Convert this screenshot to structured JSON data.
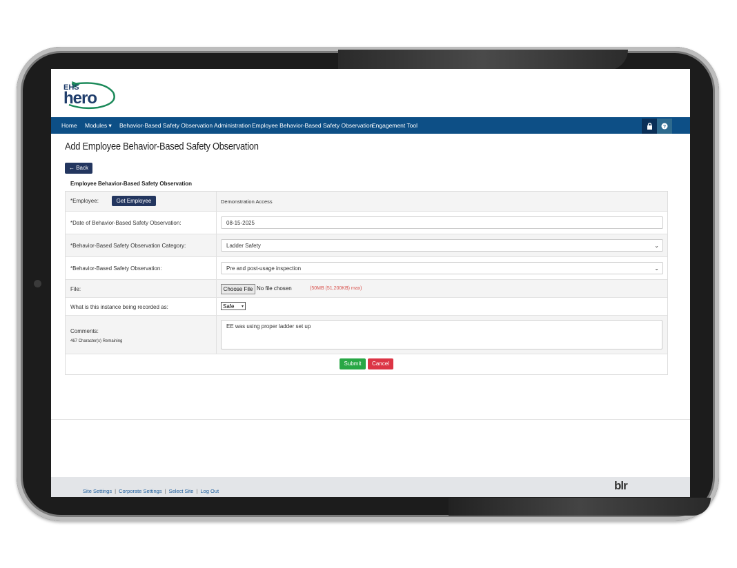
{
  "logo": {
    "small_text": "EHS",
    "main_text": "hero",
    "alt": "EHS hero"
  },
  "nav": {
    "items": [
      {
        "label": "Home"
      },
      {
        "label": "Modules ▾"
      },
      {
        "label": "Behavior-Based Safety Observation Administration"
      },
      {
        "label": "Employee Behavior-Based Safety Observation"
      },
      {
        "label": "Engagement Tool"
      }
    ],
    "lock_icon": "lock-icon",
    "help_icon": "question-circle-icon"
  },
  "page": {
    "title": "Add Employee Behavior-Based Safety Observation",
    "back_label": "← Back",
    "section_title": "Employee Behavior-Based Safety Observation"
  },
  "form": {
    "employee": {
      "label": "*Employee:",
      "button": "Get Employee",
      "value": "Demonstration Access"
    },
    "date": {
      "label": "*Date of Behavior-Based Safety Observation:",
      "value": "08-15-2025"
    },
    "category": {
      "label": "*Behavior-Based Safety Observation Category:",
      "value": "Ladder Safety"
    },
    "observation": {
      "label": "*Behavior-Based Safety Observation:",
      "value": "Pre and post-usage inspection"
    },
    "file": {
      "label": "File:",
      "button": "Choose File",
      "status": "No file chosen",
      "limit": "(50MB (51,200KB) max)"
    },
    "recorded_as": {
      "label": "What is this instance being recorded as:",
      "value": "Safe"
    },
    "comments": {
      "label": "Comments:",
      "remaining": "467 Character(s) Remaining",
      "value": "EE was using proper ladder set up"
    },
    "submit_label": "Submit",
    "cancel_label": "Cancel"
  },
  "footer": {
    "links": [
      "Site Settings",
      "Corporate Settings",
      "Select Site",
      "Log Out"
    ],
    "brand": "blr"
  }
}
